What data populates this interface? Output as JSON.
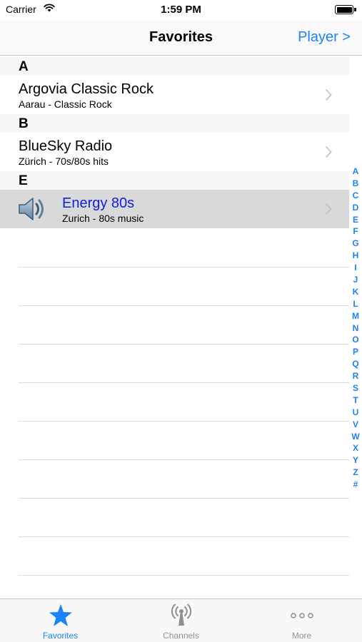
{
  "status_bar": {
    "carrier": "Carrier",
    "time": "1:59 PM"
  },
  "nav": {
    "title": "Favorites",
    "right_button": "Player >"
  },
  "sections": [
    {
      "letter": "A",
      "items": [
        {
          "title": "Argovia Classic Rock",
          "subtitle": "Aarau - Classic Rock"
        }
      ]
    },
    {
      "letter": "B",
      "items": [
        {
          "title": "BlueSky Radio",
          "subtitle": "Zürich - 70s/80s hits"
        }
      ]
    },
    {
      "letter": "E",
      "items": [
        {
          "title": "Energy 80s",
          "subtitle": "Zurich - 80s music",
          "selected": true,
          "icon": "speaker-icon"
        }
      ]
    }
  ],
  "index_letters": [
    "A",
    "B",
    "C",
    "D",
    "E",
    "F",
    "G",
    "H",
    "I",
    "J",
    "K",
    "L",
    "M",
    "N",
    "O",
    "P",
    "Q",
    "R",
    "S",
    "T",
    "U",
    "V",
    "W",
    "X",
    "Y",
    "Z",
    "#"
  ],
  "tab_bar": {
    "tabs": [
      {
        "label": "Favorites",
        "icon": "star-icon",
        "active": true
      },
      {
        "label": "Channels",
        "icon": "antenna-icon",
        "active": false
      },
      {
        "label": "More",
        "icon": "more-icon",
        "active": false
      }
    ]
  },
  "colors": {
    "accent": "#1a82fb",
    "selected_title": "#0f1fe0",
    "selected_row": "#d9d9d9",
    "section_header": "#f7f7f7"
  }
}
